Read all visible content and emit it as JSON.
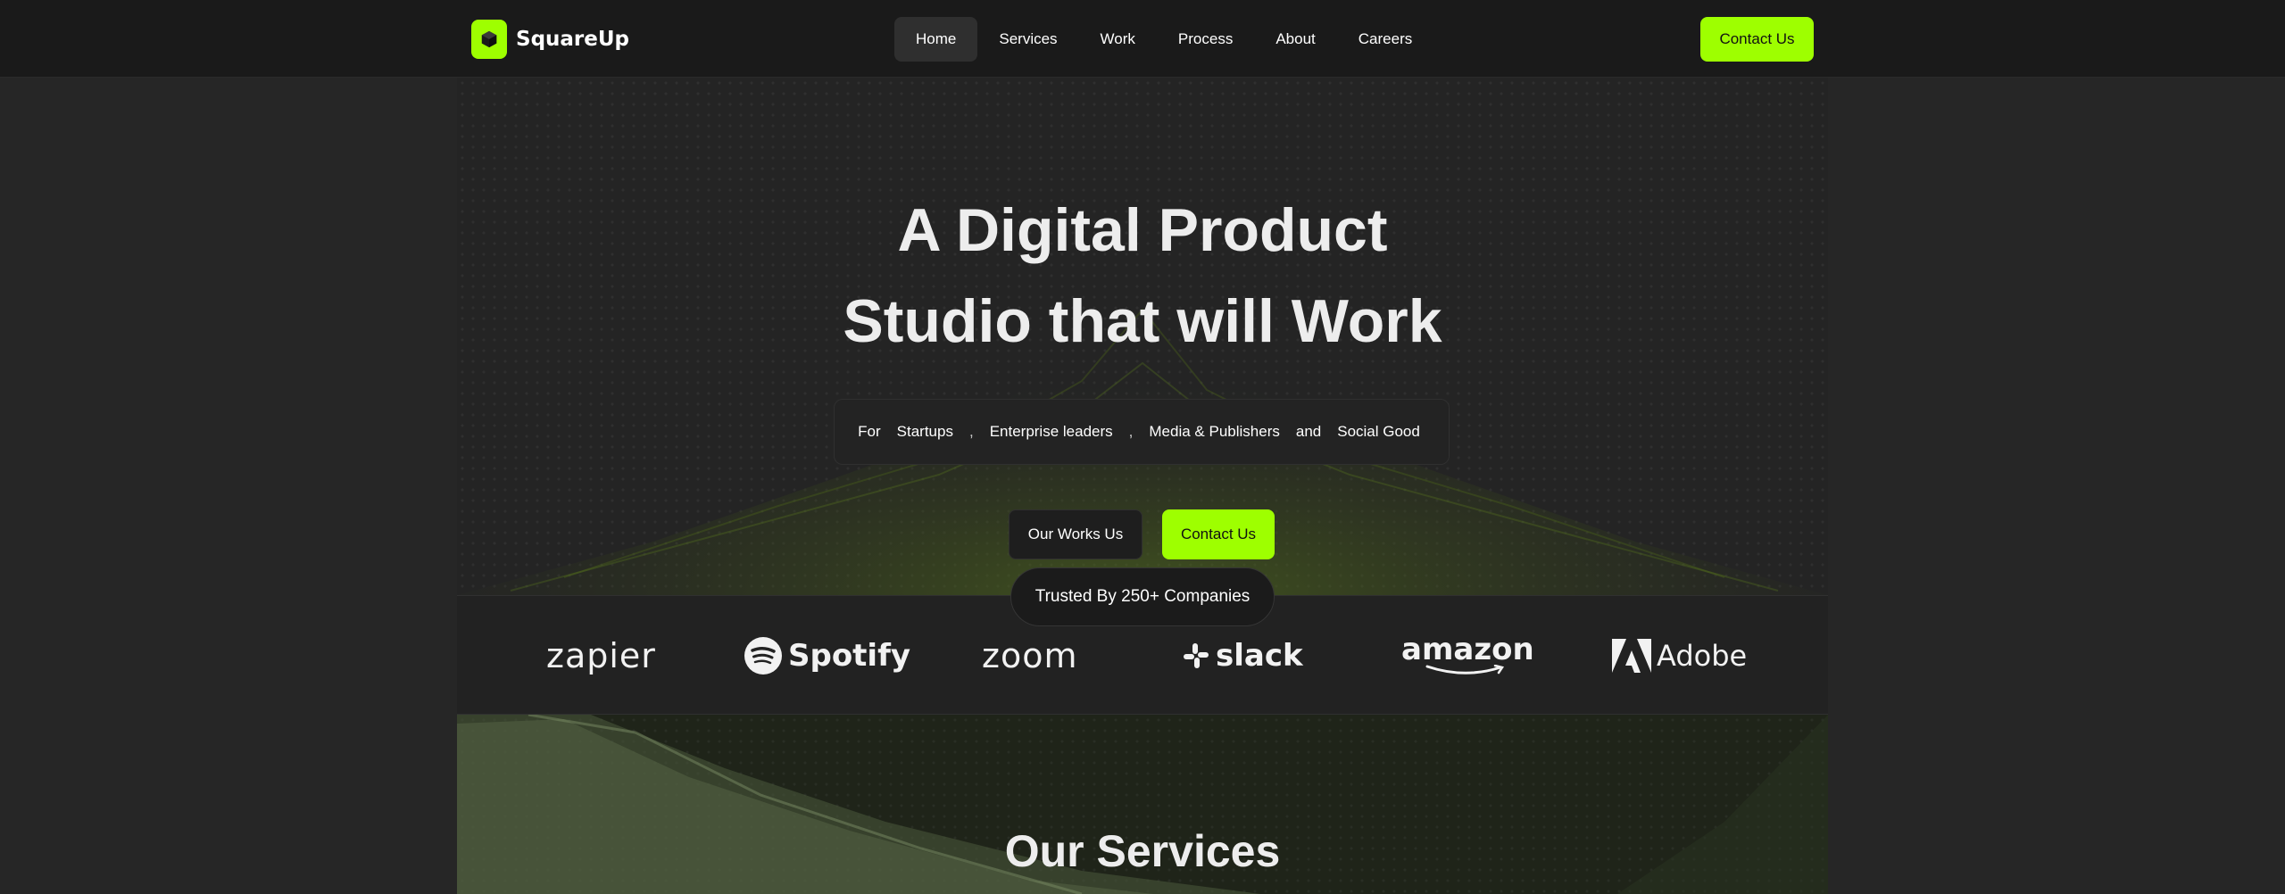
{
  "brand": {
    "name": "SquareUp",
    "accent": "#9eff00"
  },
  "nav": {
    "items": [
      {
        "label": "Home",
        "active": true
      },
      {
        "label": "Services"
      },
      {
        "label": "Work"
      },
      {
        "label": "Process"
      },
      {
        "label": "About"
      },
      {
        "label": "Careers"
      }
    ],
    "contact_label": "Contact Us"
  },
  "hero": {
    "title_line1": "A Digital Product",
    "title_line2": "Studio that will Work",
    "audience": {
      "prefix": "For",
      "items": [
        "Startups",
        "Enterprise leaders",
        "Media & Publishers",
        "Social Good"
      ],
      "sep": ",",
      "conj": "and"
    },
    "primary_button": "Our Works Us",
    "secondary_button": "Contact Us"
  },
  "trusted": {
    "label": "Trusted By 250+ Companies",
    "logos": [
      "zapier",
      "Spotify",
      "zoom",
      "slack",
      "amazon",
      "Adobe"
    ]
  },
  "services": {
    "title": "Our Services"
  }
}
